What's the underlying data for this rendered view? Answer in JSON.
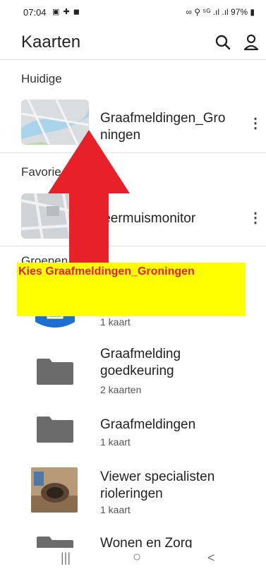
{
  "status": {
    "time": "07:04",
    "left_icons": "▣ ✚ ◼",
    "right_icons": "∞ ⚲ ⁵ᴳ .ıl .ıl 97% ▮"
  },
  "appbar": {
    "title": "Kaarten",
    "search_icon": "search-icon",
    "account_icon": "account-icon"
  },
  "sections": {
    "current": "Huidige",
    "favorites": "Favorie",
    "groups": "Groepen"
  },
  "current_item": {
    "title_line1": "Graafmeldingen_Gro",
    "title_line2": "ningen"
  },
  "favorite_item": {
    "title": "leermuismonitor"
  },
  "groups": [
    {
      "sub": "1 kaart"
    },
    {
      "title_line1": "Graafmelding",
      "title_line2": "goedkeuring",
      "sub": "2 kaarten"
    },
    {
      "title_line1": "Graafmeldingen",
      "sub": "1 kaart"
    },
    {
      "title_line1": "Viewer specialisten",
      "title_line2": "rioleringen",
      "sub": "1 kaart"
    },
    {
      "title_line1": "Wonen en Zorg"
    }
  ],
  "annotation": {
    "text": "Kies Graafmeldingen_Groningen",
    "arrow_color": "#e8202a",
    "box_color": "#ffff00"
  },
  "navbar": {
    "recents": "|||",
    "home": "○",
    "back": "<"
  }
}
